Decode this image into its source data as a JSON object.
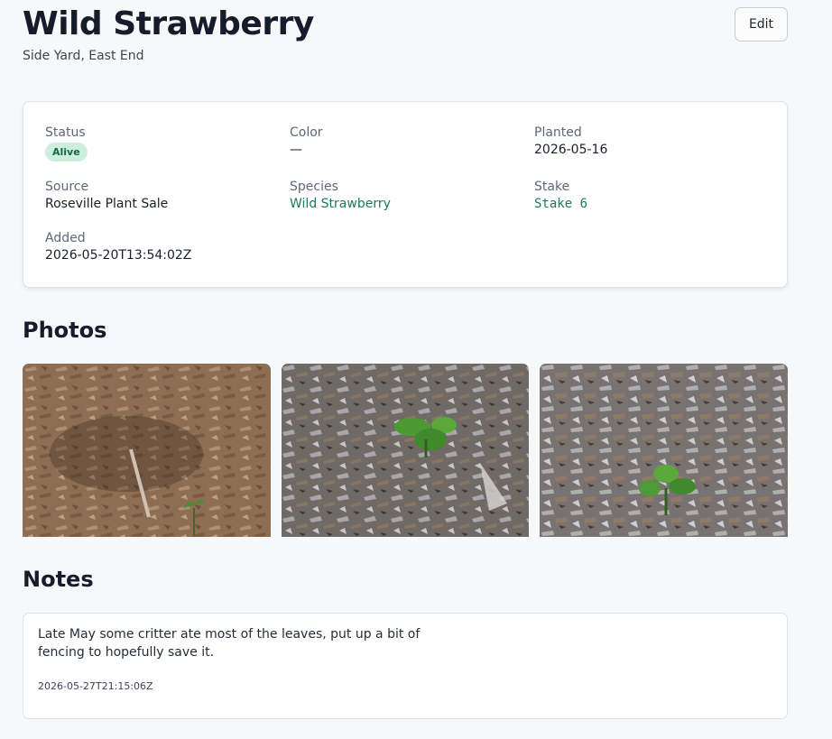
{
  "header": {
    "title": "Wild Strawberry",
    "subtitle": "Side Yard, East End",
    "edit_label": "Edit"
  },
  "details": {
    "status": {
      "label": "Status",
      "value": "Alive"
    },
    "color": {
      "label": "Color",
      "value": "—"
    },
    "planted": {
      "label": "Planted",
      "value": "2026-05-16"
    },
    "source": {
      "label": "Source",
      "value": "Roseville Plant Sale"
    },
    "species": {
      "label": "Species",
      "value": "Wild Strawberry"
    },
    "stake": {
      "label": "Stake",
      "value": "Stake 6"
    },
    "added": {
      "label": "Added",
      "value": "2026-05-20T13:54:02Z"
    }
  },
  "photos": {
    "heading": "Photos",
    "items": [
      {
        "subject": "brown wood-chip mulch with a small seedling"
      },
      {
        "subject": "gray wood-chip mulch with a strawberry plant"
      },
      {
        "subject": "gray wood-chip mulch with a strawberry plant"
      }
    ]
  },
  "notes": {
    "heading": "Notes",
    "items": [
      {
        "text": "Late May some critter ate most of the leaves, put up a bit of fencing to hopefully save it.",
        "timestamp": "2026-05-27T21:15:06Z"
      }
    ]
  },
  "colors": {
    "accent": "#1c7a55",
    "badge_bg": "#cdeedd",
    "page_bg": "#f7f8fa"
  }
}
